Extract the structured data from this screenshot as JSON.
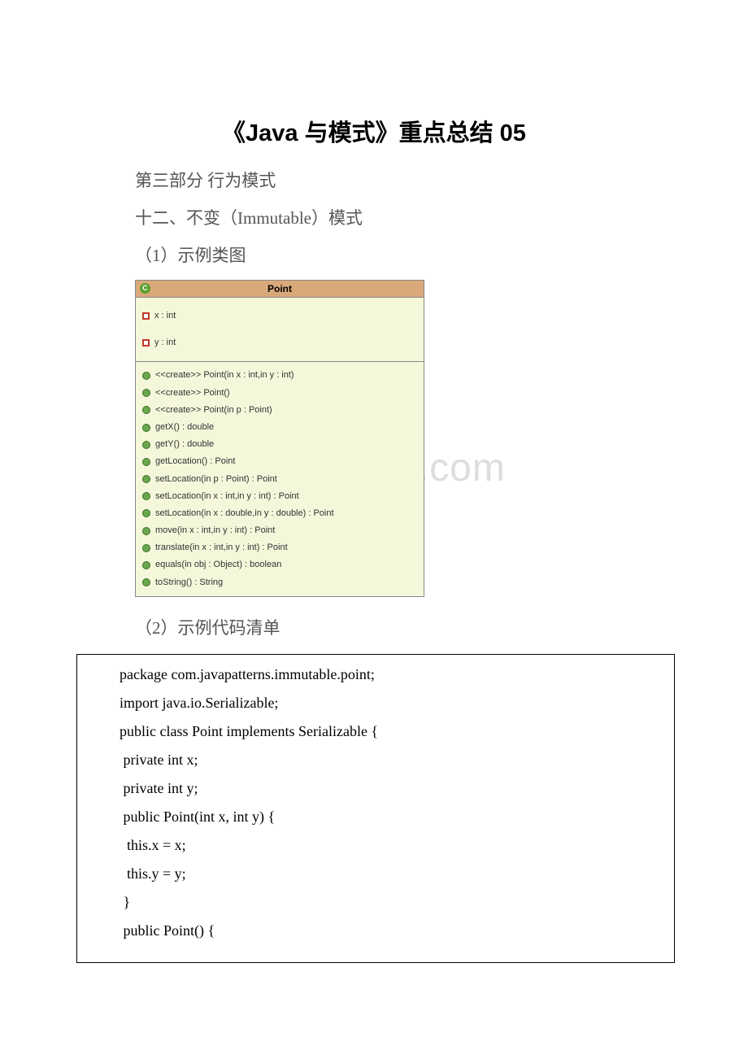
{
  "title": "《Java 与模式》重点总结 05",
  "lines": {
    "l1": "第三部分 行为模式",
    "l2": "十二、不变（Immutable）模式",
    "l3": "（1）示例类图",
    "l4": "（2）示例代码清单"
  },
  "uml": {
    "class_name": "Point",
    "class_icon": "C",
    "attrs": [
      "x : int",
      "y : int"
    ],
    "methods": [
      "<<create>> Point(in x : int,in y : int)",
      "<<create>> Point()",
      "<<create>> Point(in p : Point)",
      "getX() : double",
      "getY() : double",
      "getLocation() : Point",
      "setLocation(in p : Point) : Point",
      "setLocation(in x : int,in y : int) : Point",
      "setLocation(in x : double,in y : double) : Point",
      "move(in x : int,in y : int) : Point",
      "translate(in x : int,in y : int) : Point",
      "equals(in obj : Object) : boolean",
      "toString() : String"
    ]
  },
  "watermark": "www.bingdoc.com",
  "code": [
    "package com.javapatterns.immutable.point;",
    "import java.io.Serializable;",
    "public class Point implements Serializable {",
    " private int x;",
    " private int y;",
    " public Point(int x, int y) {",
    "  this.x = x;",
    "  this.y = y;",
    " }",
    " public Point() {"
  ]
}
